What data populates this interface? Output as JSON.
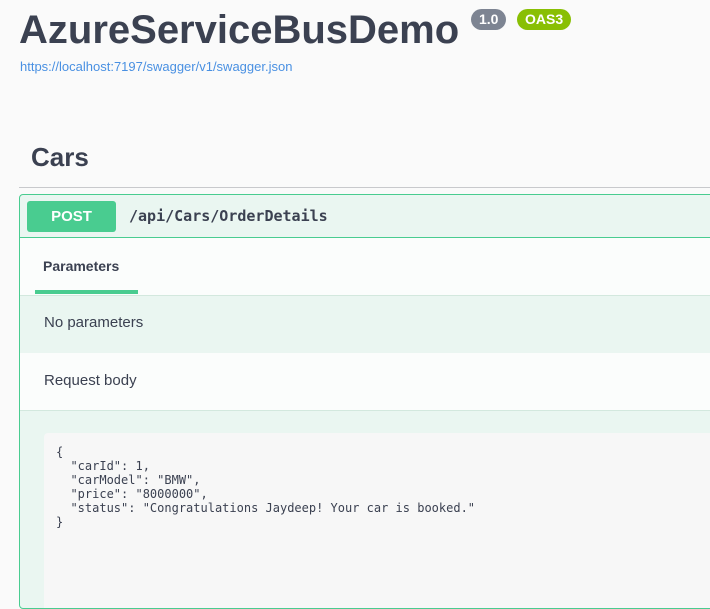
{
  "header": {
    "title": "AzureServiceBusDemo",
    "version_badge": "1.0",
    "oas_badge": "OAS3",
    "spec_url": "https://localhost:7197/swagger/v1/swagger.json"
  },
  "tag": {
    "name": "Cars"
  },
  "operation": {
    "method": "POST",
    "path": "/api/Cars/OrderDetails",
    "tabs": {
      "parameters_label": "Parameters"
    },
    "no_parameters_text": "No parameters",
    "request_body_label": "Request body",
    "request_body_example": "{\n  \"carId\": 1,\n  \"carModel\": \"BMW\",\n  \"price\": \"8000000\",\n  \"status\": \"Congratulations Jaydeep! Your car is booked.\"\n}"
  },
  "colors": {
    "post_accent": "#49cc90",
    "version_badge": "#7d8492",
    "oas_badge": "#89bf04",
    "link": "#4990e2"
  }
}
